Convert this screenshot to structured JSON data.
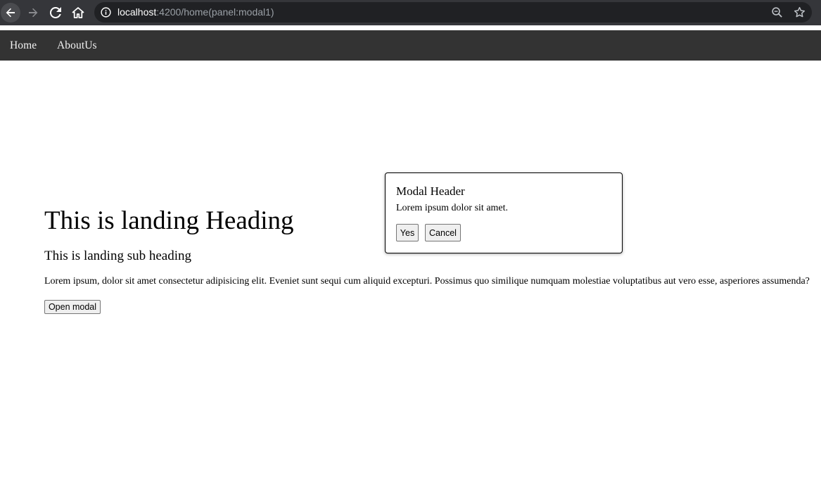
{
  "browser": {
    "url_host": "localhost",
    "url_path": ":4200/home(panel:modal1)",
    "icons": [
      "back-arrow-icon",
      "forward-arrow-icon",
      "reload-icon",
      "home-icon",
      "info-icon",
      "zoom-icon",
      "star-icon"
    ]
  },
  "nav": {
    "items": [
      {
        "label": "Home"
      },
      {
        "label": "AboutUs"
      }
    ],
    "background": "#333333"
  },
  "landing": {
    "heading": "This is landing Heading",
    "sub_heading": "This is landing sub heading",
    "text": "Lorem ipsum, dolor sit amet consectetur adipisicing elit. Eveniet sunt sequi cum aliquid excepturi. Possimus quo similique numquam molestiae voluptatibus aut vero esse, asperiores assumenda?",
    "open_modal_label": "Open modal"
  },
  "modal": {
    "header": "Modal Header",
    "body": "Lorem ipsum dolor sit amet.",
    "yes_label": "Yes",
    "cancel_label": "Cancel"
  }
}
